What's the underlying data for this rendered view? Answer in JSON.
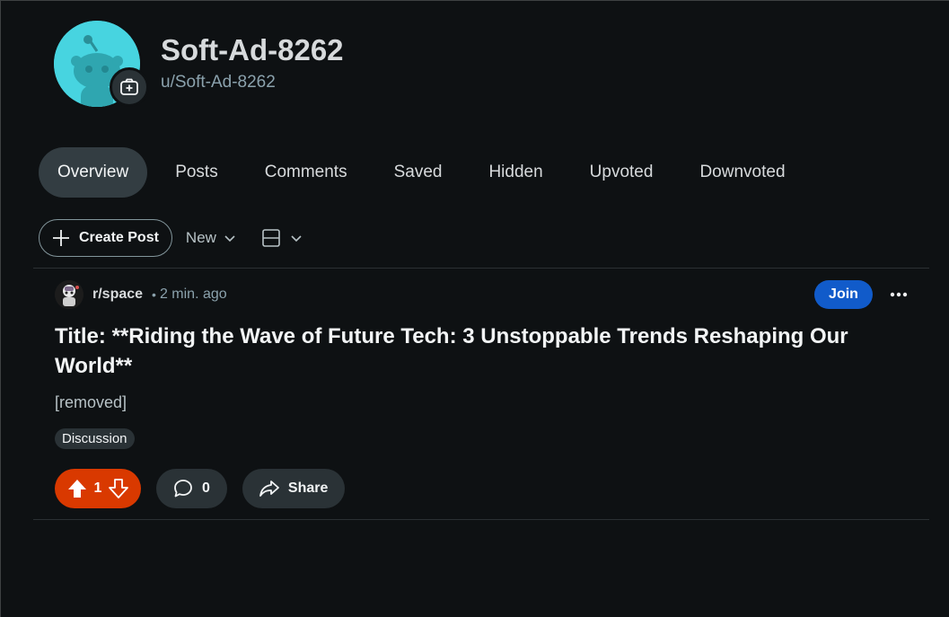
{
  "profile": {
    "display_name": "Soft-Ad-8262",
    "username": "u/Soft-Ad-8262",
    "avatar_color": "#47d4e0",
    "avatar_icon": "snoo-avatar-icon",
    "add_icon": "add-image-icon"
  },
  "tabs": [
    {
      "label": "Overview",
      "active": true
    },
    {
      "label": "Posts"
    },
    {
      "label": "Comments"
    },
    {
      "label": "Saved"
    },
    {
      "label": "Hidden"
    },
    {
      "label": "Upvoted"
    },
    {
      "label": "Downvoted"
    }
  ],
  "toolbar": {
    "create_label": "Create Post",
    "sort_label": "New"
  },
  "post": {
    "subreddit": "r/space",
    "separator": "•",
    "time": "2 min. ago",
    "join_label": "Join",
    "title": "Title: **Riding the Wave of Future Tech: 3 Unstoppable Trends Reshaping Our World**",
    "body": "[removed]",
    "flair": "Discussion",
    "score": "1",
    "comments": "0",
    "share_label": "Share"
  },
  "colors": {
    "background": "#0e1113",
    "join": "#115bca",
    "upvoted": "#d93900",
    "active_tab": "#333d42"
  }
}
